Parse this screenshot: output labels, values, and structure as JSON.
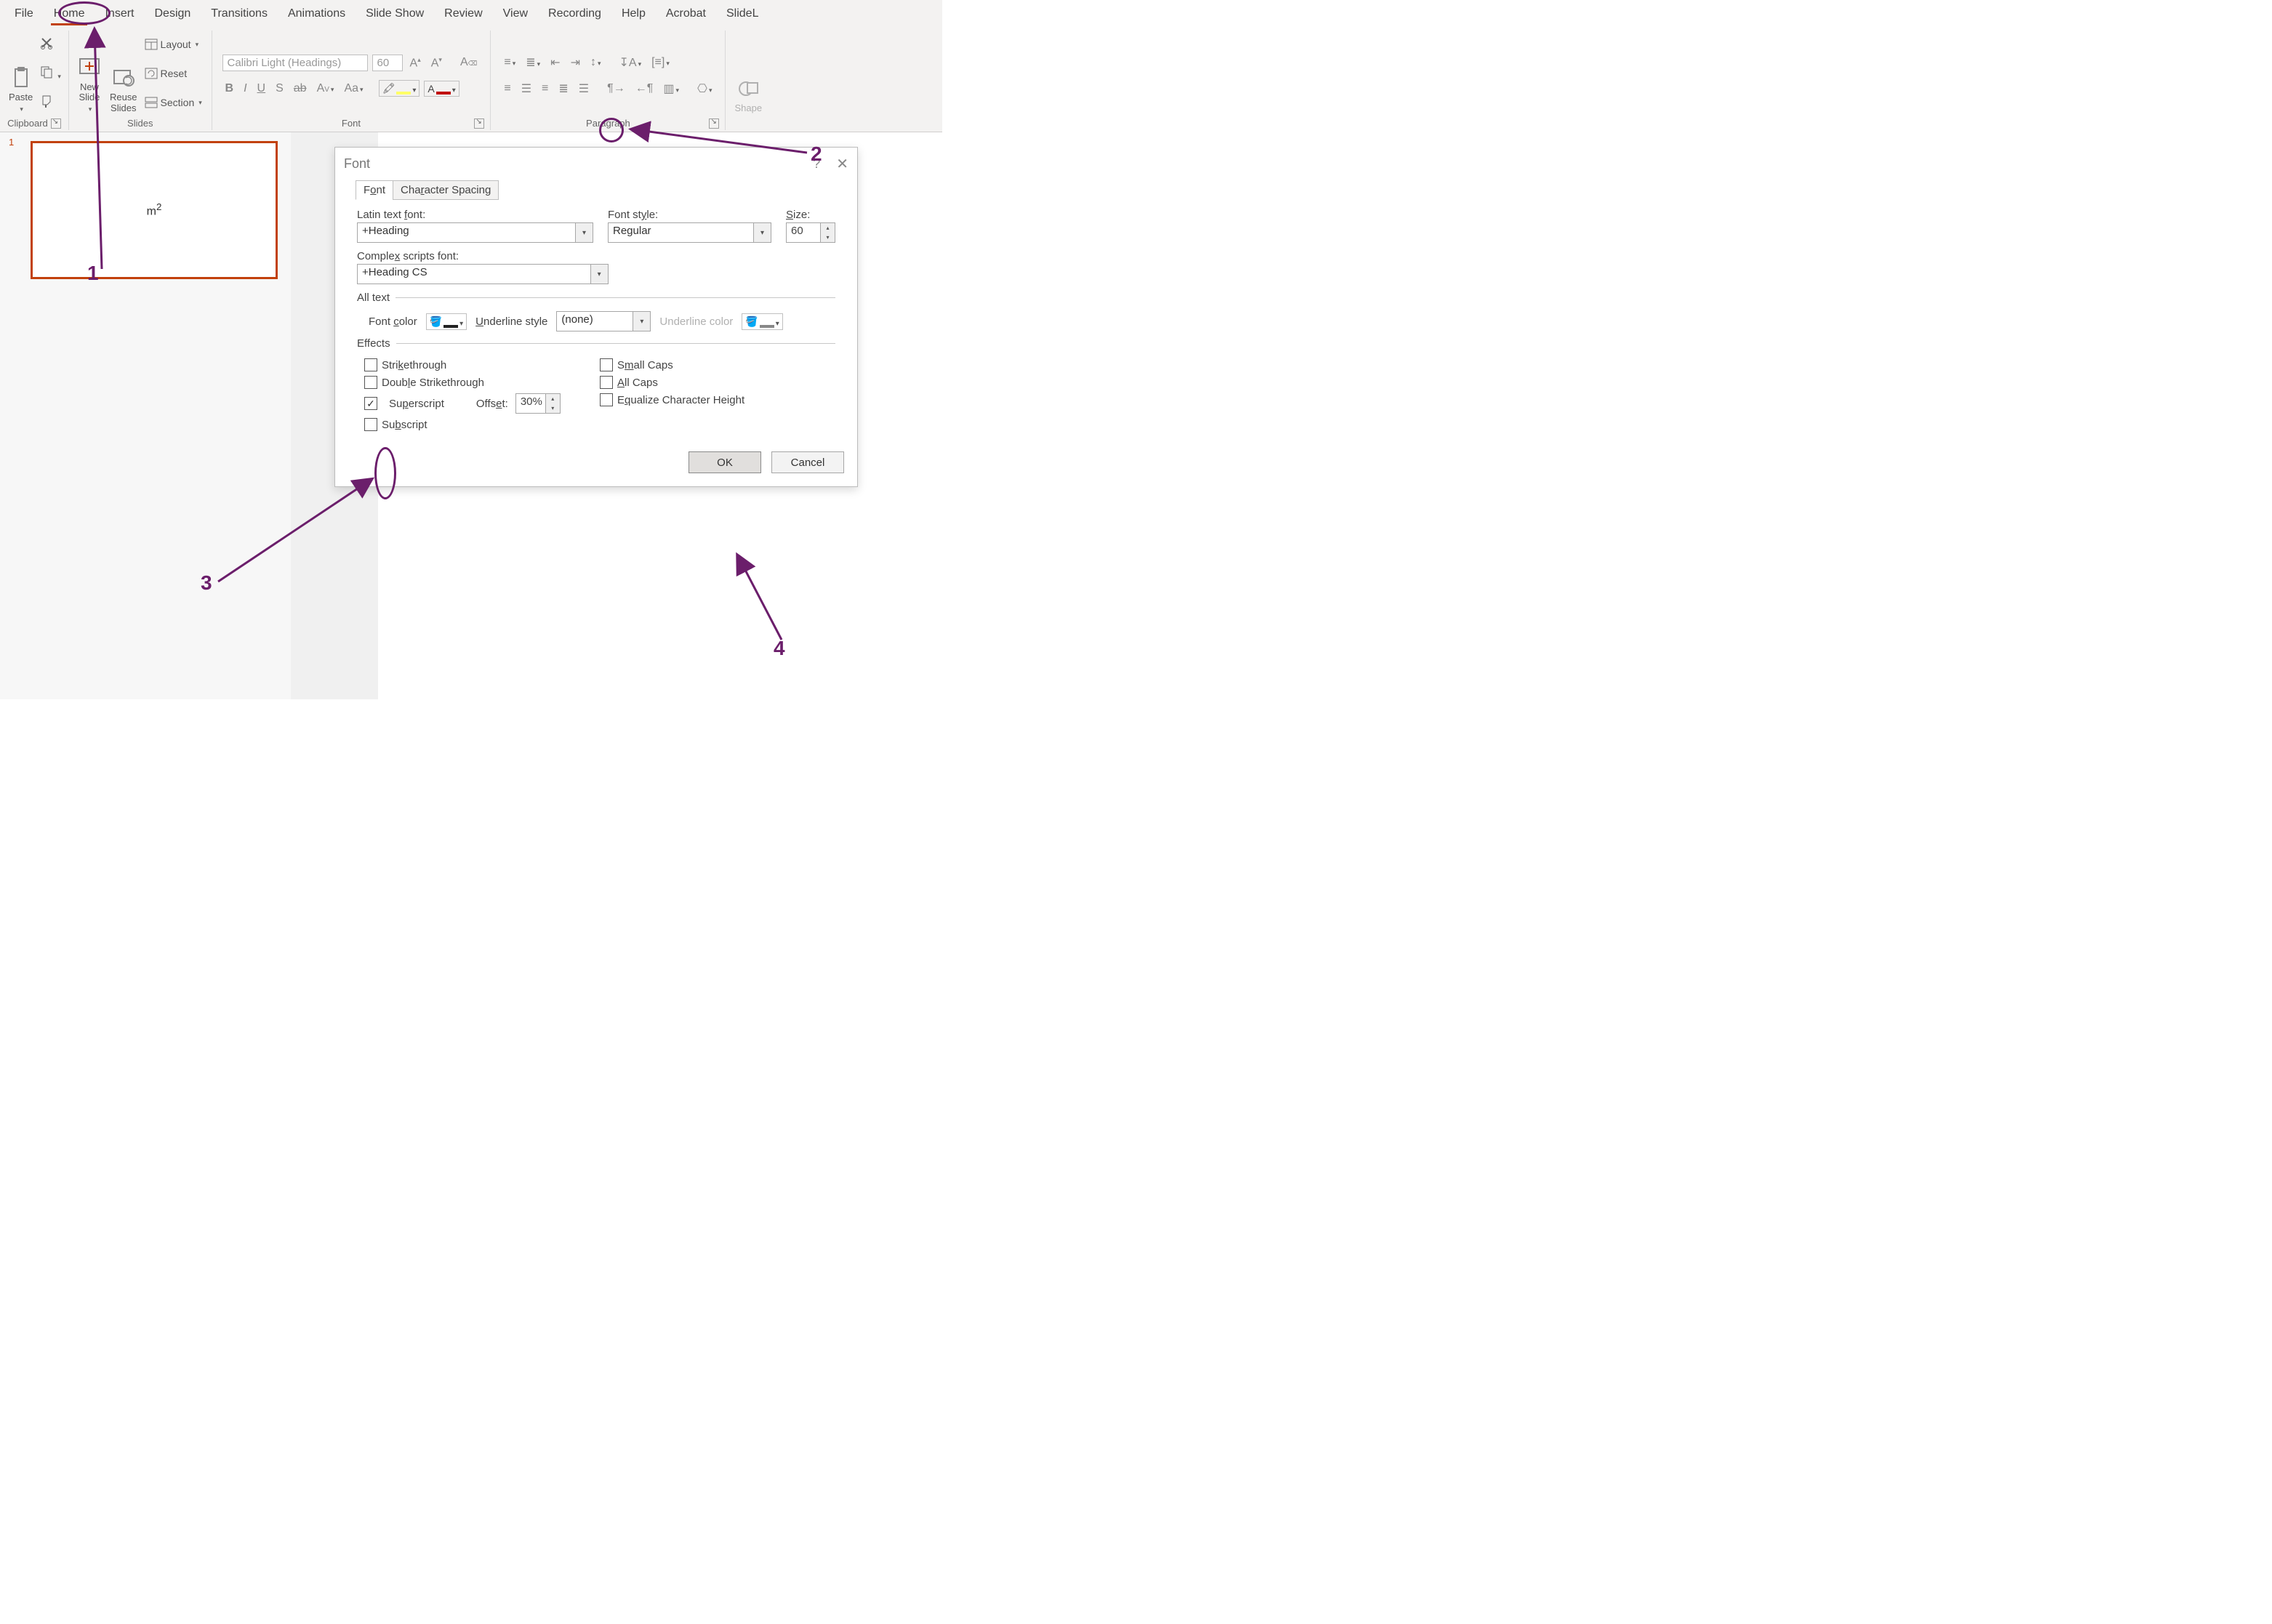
{
  "tabs": {
    "file": "File",
    "home": "Home",
    "insert": "Insert",
    "design": "Design",
    "transitions": "Transitions",
    "animations": "Animations",
    "slideshow": "Slide Show",
    "review": "Review",
    "view": "View",
    "recording": "Recording",
    "help": "Help",
    "acrobat": "Acrobat",
    "slidel": "SlideL"
  },
  "ribbon": {
    "clipboard": {
      "label": "Clipboard",
      "paste": "Paste"
    },
    "slides": {
      "label": "Slides",
      "newslide": "New\nSlide",
      "reuse": "Reuse\nSlides",
      "layout": "Layout",
      "reset": "Reset",
      "section": "Section"
    },
    "font": {
      "label": "Font",
      "name_placeholder": "Calibri Light (Headings)",
      "size_placeholder": "60",
      "bold": "B",
      "italic": "I",
      "underline": "U",
      "shadow": "S",
      "strike": "ab",
      "spacing": "AV",
      "case": "Aa",
      "grow": "A",
      "shrink": "A",
      "clear": "A"
    },
    "paragraph": {
      "label": "Paragraph"
    },
    "shapes": {
      "label": "Shape"
    }
  },
  "annotations": {
    "n1": "1",
    "n2": "2",
    "n3": "3",
    "n4": "4"
  },
  "thumbnail": {
    "num": "1",
    "text_base": "m",
    "text_sup": "2"
  },
  "dialog": {
    "title": "Font",
    "help": "?",
    "tab_font": "Font",
    "tab_spacing": "Character Spacing",
    "latin_label": "Latin text font:",
    "latin_value": "+Heading",
    "complex_label": "Complex scripts font:",
    "complex_value": "+Heading CS",
    "style_label": "Font style:",
    "style_value": "Regular",
    "size_label": "Size:",
    "size_value": "60",
    "alltext": "All text",
    "fontcolor": "Font color",
    "underlinestyle": "Underline style",
    "underlinestyle_value": "(none)",
    "underlinecolor": "Underline color",
    "effects": "Effects",
    "strike": "Strikethrough",
    "dstrike": "Double Strikethrough",
    "superscript": "Superscript",
    "subscript": "Subscript",
    "offset_label": "Offset:",
    "offset_value": "30%",
    "smallcaps": "Small Caps",
    "allcaps": "All Caps",
    "equalize": "Equalize Character Height",
    "ok": "OK",
    "cancel": "Cancel"
  }
}
